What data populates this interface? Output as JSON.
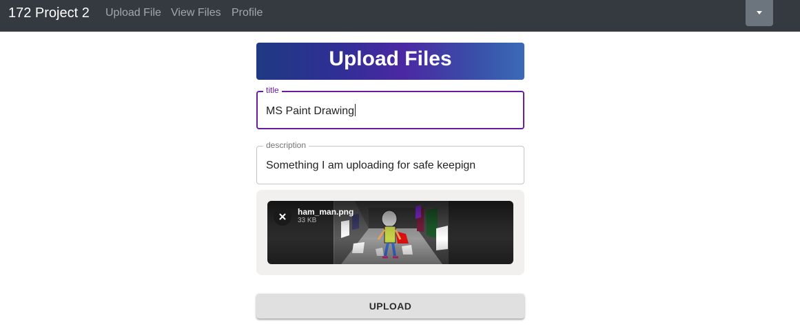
{
  "navbar": {
    "brand": "172 Project 2",
    "links": [
      "Upload File",
      "View Files",
      "Profile"
    ],
    "dropdown_icon": "caret-down-icon"
  },
  "banner": {
    "title": "Upload Files"
  },
  "form": {
    "title_field": {
      "label": "title",
      "value": "MS Paint Drawing"
    },
    "description_field": {
      "label": "description",
      "value": "Something I am uploading for safe keepign"
    }
  },
  "file": {
    "name": "ham_man.png",
    "size": "33 KB",
    "remove_icon": "close-icon"
  },
  "upload_button": {
    "label": "UPLOAD"
  },
  "colors": {
    "navbar": "#343a40",
    "focus_accent": "#6a1b9a",
    "banner_gradient": [
      "#1f3a82",
      "#4b28a3",
      "#3b6ab8"
    ],
    "button": "#e0e0e0"
  }
}
